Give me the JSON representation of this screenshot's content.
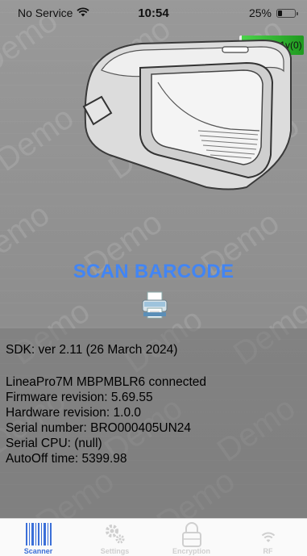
{
  "status_bar": {
    "carrier": "No Service",
    "time": "10:54",
    "battery_percent": "25%",
    "battery_level": 0.25
  },
  "device_badge": "99%,4.1v(0)",
  "main": {
    "scan_button_label": "SCAN BARCODE",
    "watermark_text": "Demo"
  },
  "info": {
    "sdk": "SDK: ver 2.11 (26 March 2024)",
    "connected": "LineaPro7M MBPMBLR6 connected",
    "firmware": "Firmware revision: 5.69.55",
    "hardware": "Hardware revision: 1.0.0",
    "serial": "Serial number: BRO000405UN24",
    "serial_cpu": "Serial CPU: (null)",
    "autooff": "AutoOff time: 5399.98"
  },
  "tabs": [
    {
      "label": "Scanner",
      "icon": "barcode-icon",
      "active": true
    },
    {
      "label": "Settings",
      "icon": "gears-icon",
      "active": false
    },
    {
      "label": "Encryption",
      "icon": "lock-icon",
      "active": false
    },
    {
      "label": "RF",
      "icon": "wifi-icon",
      "active": false
    }
  ],
  "colors": {
    "accent": "#4285f4",
    "tab_active": "#3b6fd8",
    "tab_inactive": "#cfcfcf",
    "badge_green": "#2fb52f"
  }
}
